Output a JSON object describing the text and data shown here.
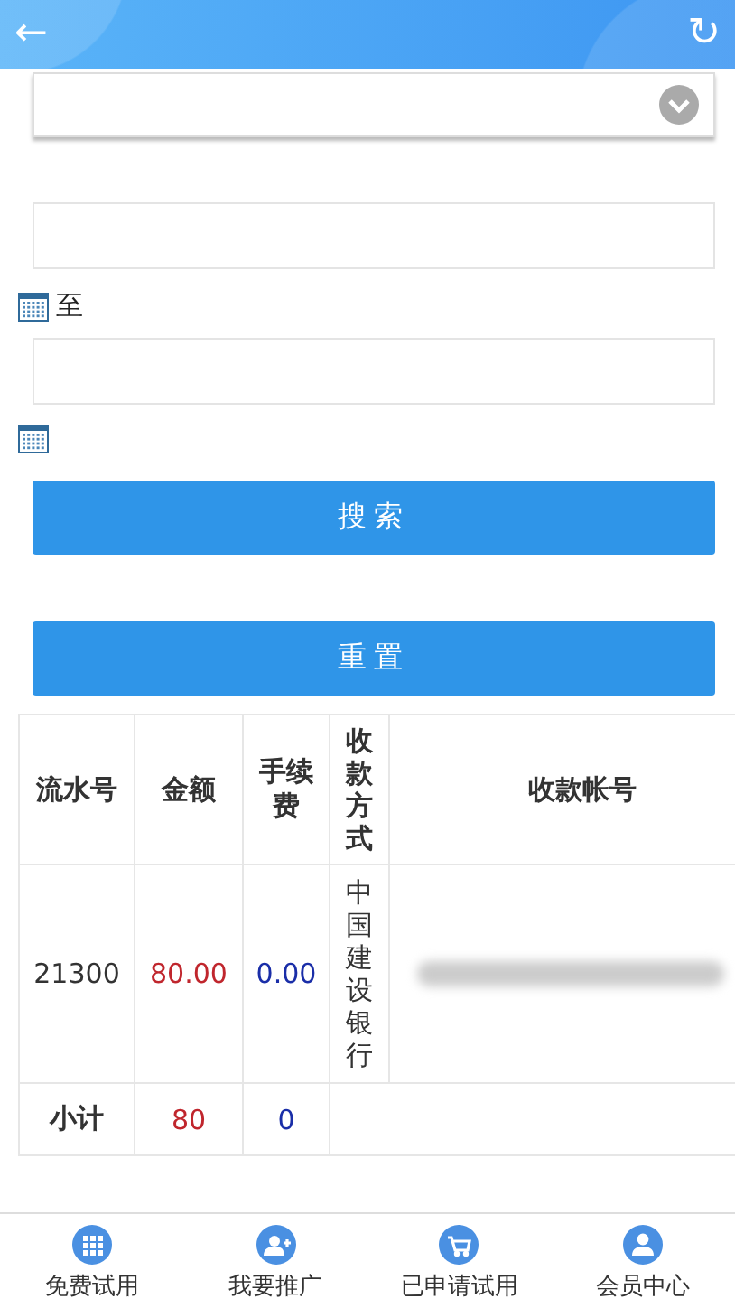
{
  "header": {
    "back": "←",
    "refresh": "↻"
  },
  "form": {
    "to_label": "至"
  },
  "buttons": [
    {
      "label": "搜索"
    },
    {
      "label": "重置"
    }
  ],
  "table": {
    "columns": [
      "流水号",
      "金额",
      "手续费",
      "收款方式",
      "收款帐号"
    ],
    "rows": [
      {
        "serial": "21300",
        "amount": "80.00",
        "fee": "0.00",
        "method": "中国建设银行",
        "account_blurred": true
      }
    ],
    "subtotal": {
      "label": "小计",
      "amount": "80",
      "fee": "0"
    }
  },
  "nav": [
    {
      "label": "免费试用",
      "kind": "grid"
    },
    {
      "label": "我要推广",
      "kind": "user-plus"
    },
    {
      "label": "已申请试用",
      "kind": "cart"
    },
    {
      "label": "会员中心",
      "kind": "user"
    }
  ]
}
